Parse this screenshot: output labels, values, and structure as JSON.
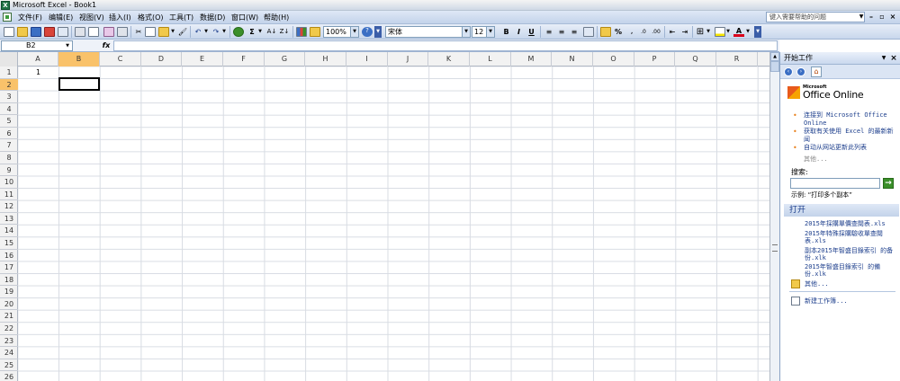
{
  "window": {
    "title": "Microsoft Excel - Book1"
  },
  "menu": {
    "items": [
      "文件(F)",
      "编辑(E)",
      "视图(V)",
      "插入(I)",
      "格式(O)",
      "工具(T)",
      "数据(D)",
      "窗口(W)",
      "帮助(H)"
    ],
    "help_placeholder": "键入需要帮助的问题"
  },
  "toolbar": {
    "zoom": "100%",
    "font": "宋体",
    "font_size": "12",
    "bold": "B",
    "italic": "I",
    "underline": "U",
    "sum_symbol": "Σ",
    "percent": "%"
  },
  "formula_bar": {
    "name_box": "B2",
    "fx_label": "fx",
    "value": ""
  },
  "grid": {
    "columns": [
      "A",
      "B",
      "C",
      "D",
      "E",
      "F",
      "G",
      "H",
      "I",
      "J",
      "K",
      "L",
      "M",
      "N",
      "O",
      "P",
      "Q",
      "R"
    ],
    "rows": [
      "1",
      "2",
      "3",
      "4",
      "5",
      "6",
      "7",
      "8",
      "9",
      "10",
      "11",
      "12",
      "13",
      "14",
      "15",
      "16",
      "17",
      "18",
      "19",
      "20",
      "21",
      "22",
      "23",
      "24",
      "25",
      "26"
    ],
    "active_cell": "B2",
    "cell_A1": "1"
  },
  "task_pane": {
    "title": "开始工作",
    "logo_ms": "Microsoft",
    "logo_text": "Office Online",
    "links": [
      "连接到 Microsoft Office Online",
      "获取有关使用 Excel 的最新新闻",
      "自动从网站更新此列表"
    ],
    "more": "其他...",
    "search_label": "搜索:",
    "search_go": "→",
    "example": "示例: “打印多个副本”",
    "open_header": "打开",
    "recent_files": [
      "2015年採購單價查閱表.xls",
      "2015年特殊採購驗收單查閱表.xls",
      "副本2015年智盛目錄索引 的备份.xlk",
      "2015年智盛目錄索引 的備份.xlk"
    ],
    "open_more": "其他...",
    "new_workbook": "新建工作簿..."
  }
}
